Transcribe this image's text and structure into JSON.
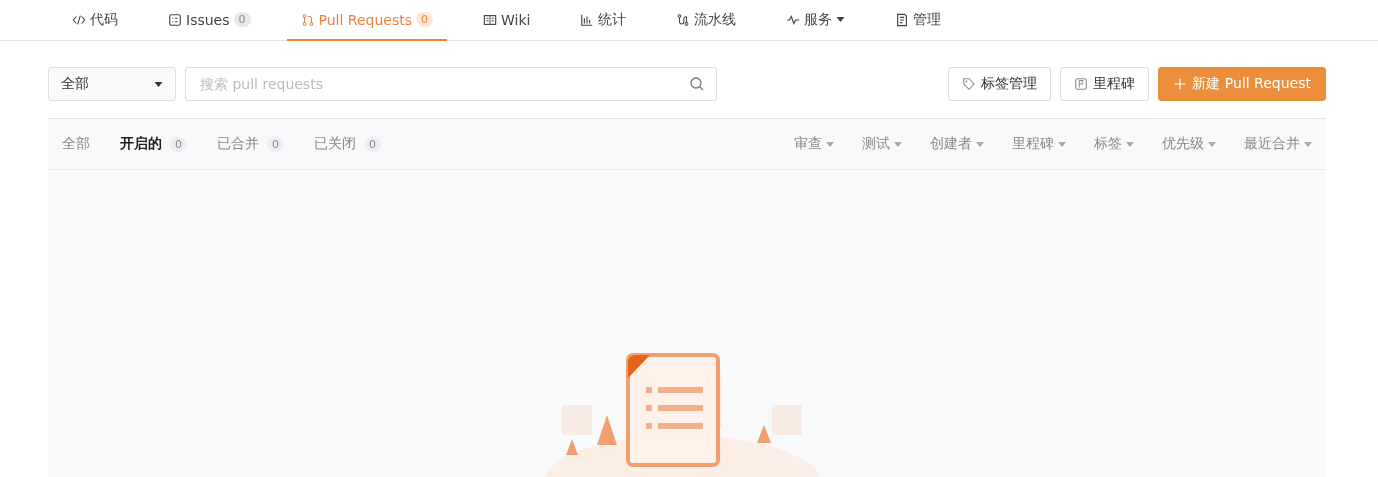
{
  "nav_tabs": [
    {
      "kind": "code",
      "label": "代码",
      "selected": false
    },
    {
      "kind": "issues",
      "label": "Issues",
      "count": "0",
      "selected": false
    },
    {
      "kind": "pr",
      "label": "Pull Requests",
      "count": "0",
      "selected": true
    },
    {
      "kind": "wiki",
      "label": "Wiki",
      "selected": false
    },
    {
      "kind": "stats",
      "label": "统计",
      "selected": false
    },
    {
      "kind": "pipeline",
      "label": "流水线",
      "selected": false
    },
    {
      "kind": "services",
      "label": "服务",
      "dropdown": true,
      "selected": false
    },
    {
      "kind": "manage",
      "label": "管理",
      "selected": false
    }
  ],
  "scope_select": {
    "value": "全部"
  },
  "search": {
    "placeholder": "搜索 pull requests"
  },
  "actions": [
    {
      "kind": "labels",
      "label": "标签管理"
    },
    {
      "kind": "milestones",
      "label": "里程碑"
    },
    {
      "kind": "new",
      "label": "新建 Pull Request"
    }
  ],
  "state_tabs": [
    {
      "label": "全部",
      "selected": false
    },
    {
      "label": "开启的",
      "count": "0",
      "selected": true
    },
    {
      "label": "已合并",
      "count": "0",
      "selected": false
    },
    {
      "label": "已关闭",
      "count": "0",
      "selected": false
    }
  ],
  "filters": [
    "审查",
    "测试",
    "创建者",
    "里程碑",
    "标签",
    "优先级",
    "最近合并"
  ],
  "empty_state": {
    "kind": "picture"
  }
}
